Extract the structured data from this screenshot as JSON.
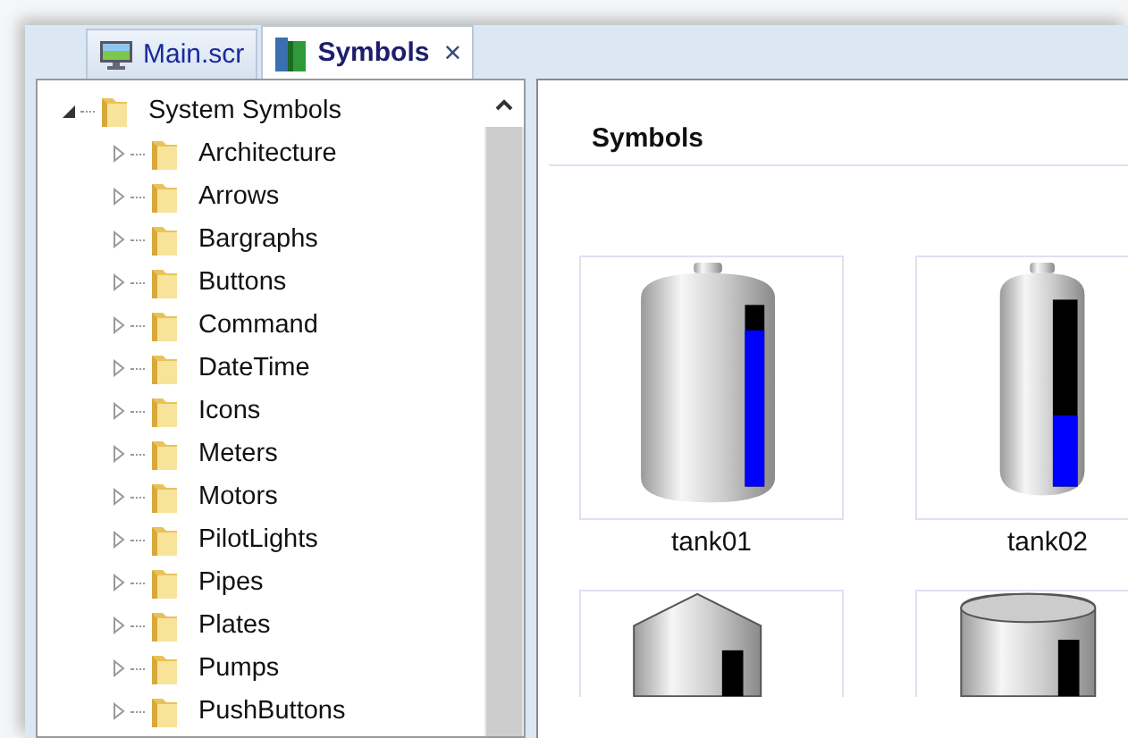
{
  "tabs": [
    {
      "label": "Main.scr",
      "kind": "screen",
      "selected": false
    },
    {
      "label": "Symbols",
      "kind": "library",
      "selected": true,
      "close": "×"
    }
  ],
  "tree": {
    "label": "System Symbols",
    "expanded": true,
    "children": [
      {
        "label": "Architecture",
        "expanded": false
      },
      {
        "label": "Arrows",
        "expanded": false
      },
      {
        "label": "Bargraphs",
        "expanded": false
      },
      {
        "label": "Buttons",
        "expanded": false
      },
      {
        "label": "Command",
        "expanded": false
      },
      {
        "label": "DateTime",
        "expanded": false
      },
      {
        "label": "Icons",
        "expanded": false
      },
      {
        "label": "Meters",
        "expanded": false
      },
      {
        "label": "Motors",
        "expanded": false
      },
      {
        "label": "PilotLights",
        "expanded": false
      },
      {
        "label": "Pipes",
        "expanded": false
      },
      {
        "label": "Plates",
        "expanded": false
      },
      {
        "label": "Pumps",
        "expanded": false
      },
      {
        "label": "PushButtons",
        "expanded": false
      }
    ]
  },
  "panel": {
    "title": "Symbols"
  },
  "symbols": [
    {
      "kind": "tank",
      "label": "tank01",
      "level": 0.86
    },
    {
      "kind": "slim-tank",
      "label": "tank02",
      "level": 0.38
    },
    {
      "kind": "silo"
    },
    {
      "kind": "drum"
    }
  ]
}
